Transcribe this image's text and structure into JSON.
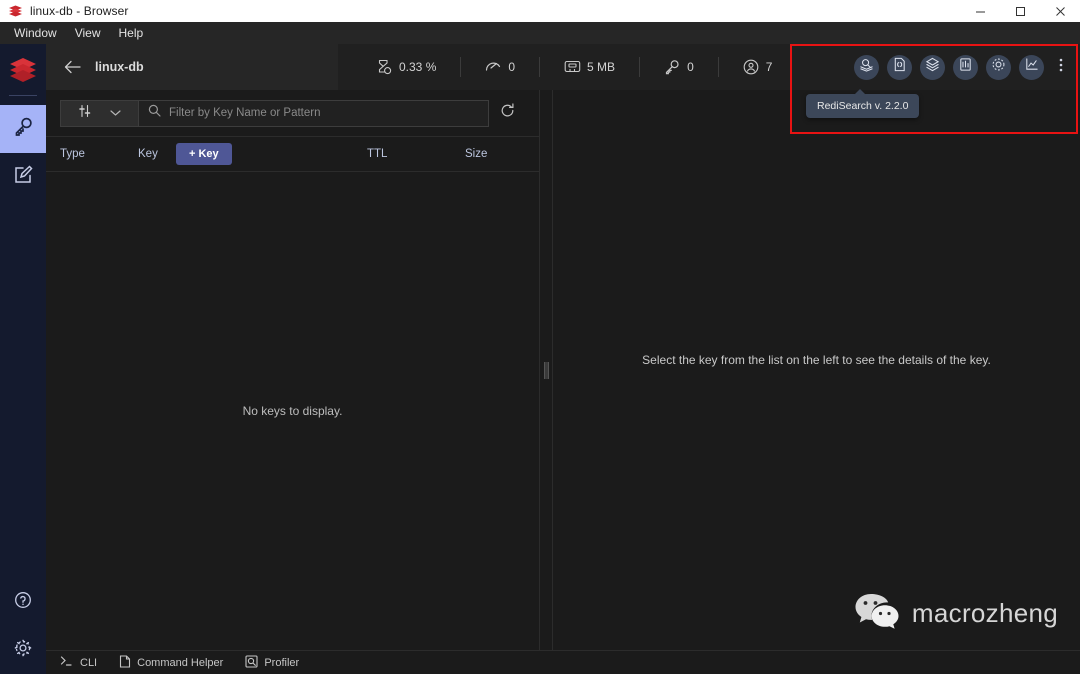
{
  "window": {
    "title": "linux-db - Browser",
    "app_icon": "redis-logo-icon",
    "controls": {
      "minimize": "minimize-icon",
      "maximize": "maximize-icon",
      "close": "close-icon"
    }
  },
  "menubar": {
    "items": [
      "Window",
      "View",
      "Help"
    ]
  },
  "rail": {
    "logo": "redis-logo-icon",
    "items": [
      {
        "name": "browser",
        "icon": "key-icon",
        "active": true
      },
      {
        "name": "workbench",
        "icon": "edit-square-icon",
        "active": false
      }
    ],
    "bottom_items": [
      {
        "name": "help",
        "icon": "question-circle-icon"
      },
      {
        "name": "settings",
        "icon": "gear-icon"
      }
    ]
  },
  "topbar": {
    "back_icon": "arrow-left-icon",
    "db_name": "linux-db",
    "metrics": [
      {
        "name": "cpu",
        "icon": "hourglass-icon",
        "value": "0.33 %"
      },
      {
        "name": "commands-per-sec",
        "icon": "speedometer-icon",
        "value": "0"
      },
      {
        "name": "memory",
        "icon": "memory-chip-icon",
        "value": "5 MB"
      },
      {
        "name": "keys",
        "icon": "key-icon",
        "value": "0"
      },
      {
        "name": "connected-clients",
        "icon": "user-circle-icon",
        "value": "7"
      }
    ],
    "module_icons": [
      {
        "name": "redisearch",
        "icon": "search-stack-icon"
      },
      {
        "name": "redisjson",
        "icon": "json-document-icon"
      },
      {
        "name": "redisgraph",
        "icon": "graph-layers-icon"
      },
      {
        "name": "redistimeseries",
        "icon": "timeseries-grid-icon"
      },
      {
        "name": "redisgears",
        "icon": "gear-icon"
      },
      {
        "name": "redisai",
        "icon": "line-chart-icon"
      },
      {
        "name": "more-modules",
        "icon": "dots-vertical-icon"
      }
    ]
  },
  "tooltip": {
    "text": "RediSearch v. 2.2.0"
  },
  "keys_pane": {
    "filter": {
      "type_selector_icon": "sliders-icon",
      "chevron_icon": "chevron-down-icon",
      "search_icon": "search-icon",
      "placeholder": "Filter by Key Name or Pattern",
      "value": "",
      "refresh_icon": "refresh-icon"
    },
    "columns": {
      "type": "Type",
      "key": "Key",
      "ttl": "TTL",
      "size": "Size"
    },
    "add_key_label": "+ Key",
    "empty_message": "No keys to display."
  },
  "detail_pane": {
    "message": "Select the key from the list on the left to see the details of the key.",
    "watermark": {
      "icon": "wechat-icon",
      "text": "macrozheng"
    }
  },
  "statusbar": {
    "items": [
      {
        "name": "cli",
        "icon": "terminal-icon",
        "label": "CLI"
      },
      {
        "name": "command-helper",
        "icon": "document-icon",
        "label": "Command Helper"
      },
      {
        "name": "profiler",
        "icon": "profiler-icon",
        "label": "Profiler"
      }
    ]
  },
  "annotation": {
    "color": "#e81313"
  }
}
